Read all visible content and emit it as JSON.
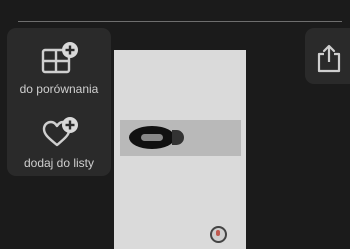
{
  "actions": {
    "compare": {
      "label": "do porównania",
      "icon": "compare-add-icon"
    },
    "wishlist": {
      "label": "dodaj do listy",
      "icon": "heart-add-icon"
    }
  },
  "share": {
    "icon": "share-icon"
  },
  "colors": {
    "background": "#1b1b1b",
    "panel": "#2a2a2a",
    "icon": "#cfcfcf"
  }
}
